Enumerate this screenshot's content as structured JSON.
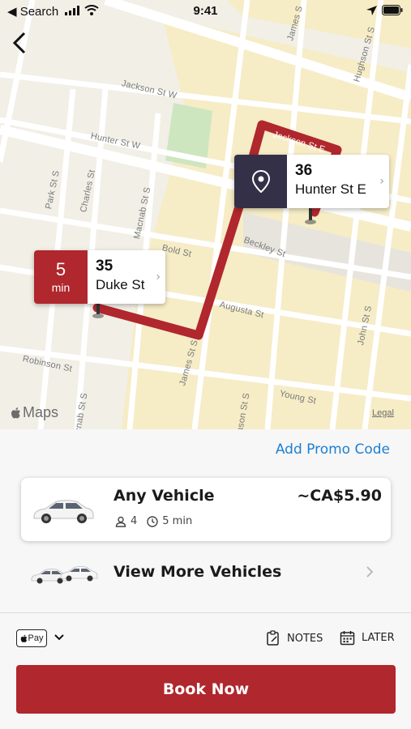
{
  "status_bar": {
    "back_app": "◀ Search",
    "time": "9:41"
  },
  "map": {
    "streets": {
      "jackson_w": "Jackson St W",
      "jackson_e": "Jackson St E",
      "hunter_w": "Hunter St W",
      "park": "Park St S",
      "charles": "Charles St",
      "macnab": "Macnab St S",
      "macnab_lower": "cnab St S",
      "bold": "Bold St",
      "beckley": "Beckley St",
      "augusta": "Augusta St",
      "james_bottom": "James St S",
      "james_top": "James S",
      "hughson_top": "Hughson St S",
      "hughson_bottom": "hson St S",
      "robinson": "Robinson St",
      "young": "Young St",
      "john": "John St S"
    },
    "destination": {
      "number": "36",
      "street": "Hunter St E"
    },
    "origin": {
      "eta_value": "5",
      "eta_unit": "min",
      "number": "35",
      "street": "Duke St"
    },
    "maps_logo": "Maps",
    "legal": "Legal",
    "route_color": "#b0272d",
    "destination_color": "#333047"
  },
  "sheet": {
    "promo_label": "Add Promo Code",
    "vehicle": {
      "name": "Any Vehicle",
      "price": "~CA$5.90",
      "seats": "4",
      "eta": "5 min"
    },
    "more_vehicles_label": "View More Vehicles",
    "payment": {
      "apple_pay_label": "Pay"
    },
    "notes_label": "NOTES",
    "later_label": "LATER",
    "book_label": "Book Now"
  }
}
